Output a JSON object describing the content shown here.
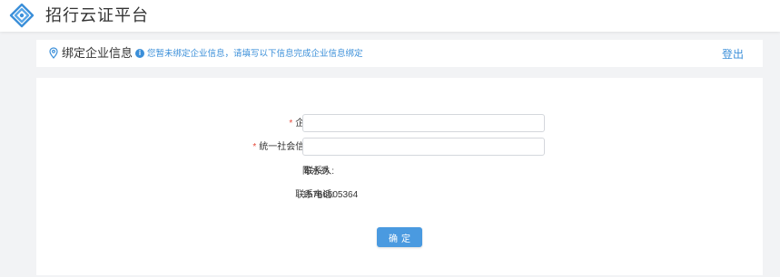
{
  "app": {
    "title": "招行云证平台",
    "logo_icon": "cmb-logo-icon",
    "brand_color": "#3b8fd9"
  },
  "header": {
    "title": "绑定企业信息",
    "title_icon": "location-pin-icon",
    "notice_icon": "info-icon",
    "notice": "您暂未绑定企业信息，请填写以下信息完成企业信息绑定",
    "logout_label": "登出"
  },
  "form": {
    "required_mark": "*",
    "fields": [
      {
        "label": "企业名称:",
        "required": true,
        "value": "",
        "type": "input"
      },
      {
        "label": "统一社会信用代码:",
        "required": true,
        "value": "",
        "type": "input"
      },
      {
        "label": "联系人:",
        "required": false,
        "value": "陈水秀",
        "type": "text"
      },
      {
        "label": "联系电话:",
        "required": false,
        "value": "15766505364",
        "type": "text"
      }
    ],
    "submit_label": "确定"
  },
  "colors": {
    "accent": "#3b8fd9",
    "button": "#4a9ae0",
    "required": "#e64a3b",
    "background": "#f2f3f5"
  }
}
